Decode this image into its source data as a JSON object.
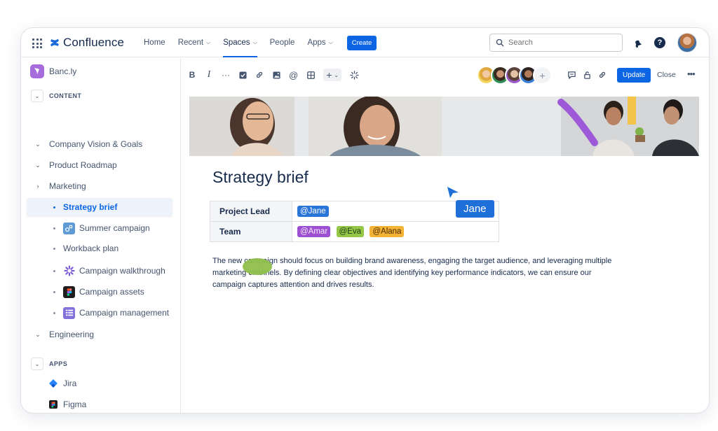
{
  "nav": {
    "app_name": "Confluence",
    "items": [
      {
        "label": "Home",
        "chevron": false,
        "active": false
      },
      {
        "label": "Recent",
        "chevron": true,
        "active": false
      },
      {
        "label": "Spaces",
        "chevron": true,
        "active": true
      },
      {
        "label": "People",
        "chevron": false,
        "active": false
      },
      {
        "label": "Apps",
        "chevron": true,
        "active": false
      }
    ],
    "create_label": "Create",
    "search_placeholder": "Search"
  },
  "sidebar": {
    "space_name": "Banc.ly",
    "content_section": "CONTENT",
    "tree": [
      {
        "label": "Company Vision & Goals",
        "toggle": "expanded"
      },
      {
        "label": "Product Roadmap",
        "toggle": "expanded"
      },
      {
        "label": "Marketing",
        "toggle": "collapsed"
      }
    ],
    "children": [
      {
        "label": "Strategy brief",
        "icon": "none",
        "selected": true
      },
      {
        "label": "Summer campaign",
        "icon": "whiteboard-icon"
      },
      {
        "label": "Workback plan",
        "icon": "none"
      },
      {
        "label": "Campaign walkthrough",
        "icon": "loom-icon"
      },
      {
        "label": "Campaign assets",
        "icon": "figma-icon"
      },
      {
        "label": "Campaign management",
        "icon": "database-icon"
      }
    ],
    "engineering": "Engineering",
    "apps_section": "APPS",
    "apps": [
      {
        "label": "Jira",
        "icon": "jira-icon"
      },
      {
        "label": "Figma",
        "icon": "figma-icon"
      }
    ]
  },
  "editor": {
    "update_label": "Update",
    "close_label": "Close",
    "more_label": "•••"
  },
  "page": {
    "title": "Strategy brief",
    "table": {
      "row1_label": "Project Lead",
      "lead": "@Jane",
      "row2_label": "Team",
      "team": [
        "@Amar",
        "@Eva",
        "@Alana"
      ]
    },
    "cursor_name": "Jane",
    "body_line1": "The new campaign should focus on building brand awareness, engaging the target audience, and leveraging multiple",
    "body_line2": "marketing channels. By defining clear objectives and identifying key performance indicators, we can ensure our",
    "body_line3": "campaign captures attention and drives results."
  },
  "colors": {
    "accent": "#0c66e4",
    "mention_blue": "#2a75d8",
    "mention_purple": "#9c4fd1",
    "mention_green": "#94c748",
    "mention_orange": "#f5b335",
    "space_icon": "#a66cdb"
  }
}
